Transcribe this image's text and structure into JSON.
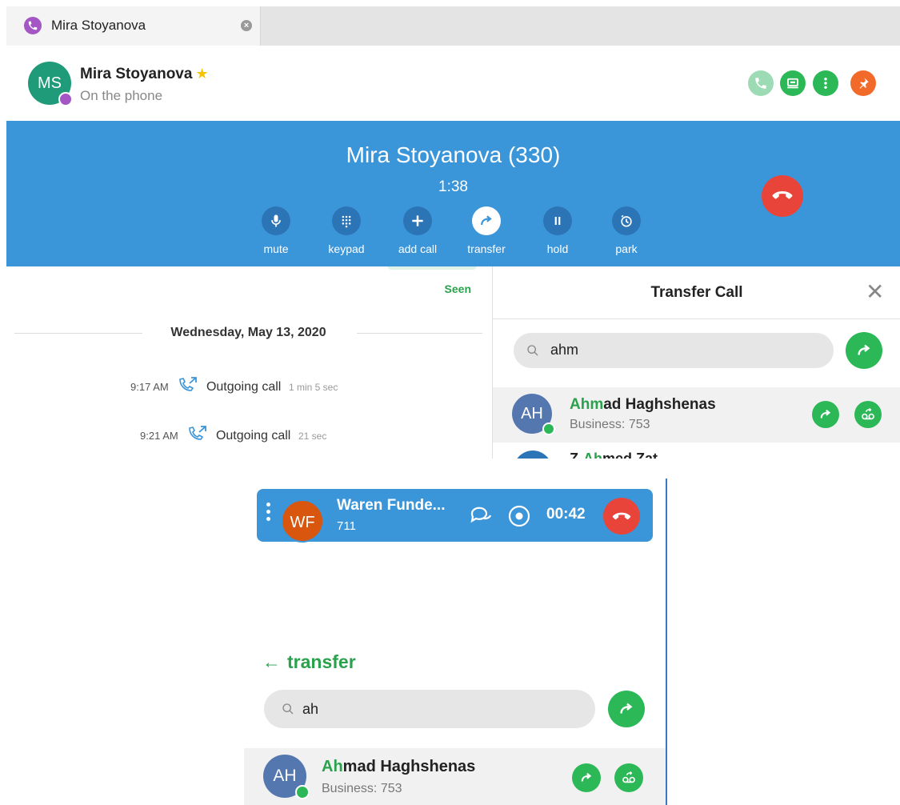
{
  "tab": {
    "title": "Mira Stoyanova",
    "close_glyph": "×"
  },
  "contact": {
    "initials": "MS",
    "name": "Mira Stoyanova",
    "favorite_glyph": "★",
    "status": "On the phone",
    "actions": [
      "call-icon",
      "screen-share-icon",
      "more-vertical-icon",
      "pin-icon"
    ]
  },
  "call": {
    "title": "Mira Stoyanova (330)",
    "timer": "1:38",
    "controls": {
      "mute": "mute",
      "keypad": "keypad",
      "add_call": "add call",
      "transfer": "transfer",
      "hold": "hold",
      "park": "park"
    }
  },
  "chat": {
    "seen": "Seen",
    "date": "Wednesday, May 13, 2020",
    "logs": [
      {
        "time": "9:17 AM",
        "kind": "Outgoing call",
        "duration": "1 min 5 sec"
      },
      {
        "time": "9:21 AM",
        "kind": "Outgoing call",
        "duration": "21 sec"
      }
    ]
  },
  "transfer": {
    "title": "Transfer Call",
    "close_glyph": "✕",
    "query": "ahm",
    "result": {
      "initials": "AH",
      "name_match": "Ahm",
      "name_rest": "ad Haghshenas",
      "sub": "Business: 753"
    },
    "next_row_partial": {
      "match": "Ah",
      "prefix": "Z-",
      "suffix": "med Zat"
    }
  },
  "mini_call": {
    "initials": "WF",
    "name": "Waren Funde...",
    "number": "711",
    "timer": "00:42"
  },
  "bottom_transfer": {
    "back_glyph": "←",
    "title": "transfer",
    "query": "ah",
    "result": {
      "initials": "AH",
      "name_match": "Ah",
      "name_rest": "mad Haghshenas",
      "sub": "Business: 753"
    }
  },
  "colors": {
    "call_blue": "#3b95d9",
    "accent_green": "#2cb857",
    "hangup_red": "#e9443a",
    "purple": "#a456c4"
  }
}
